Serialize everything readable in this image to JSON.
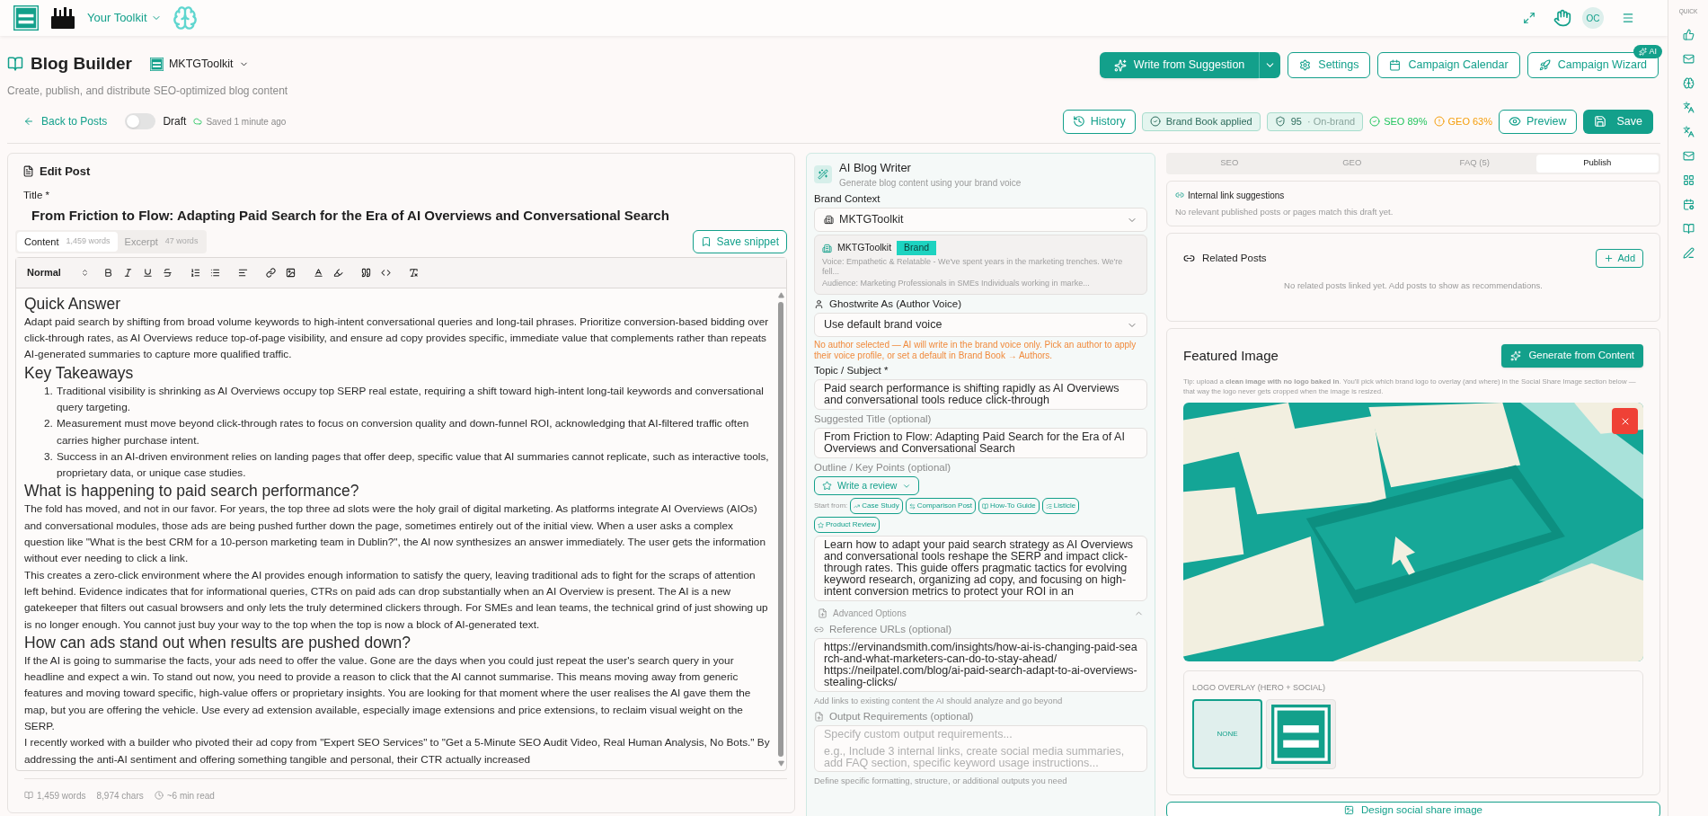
{
  "top_bar": {
    "toolkit_label": "Your Toolkit",
    "avatar": "OC"
  },
  "quick_rail": {
    "title": "QUICK"
  },
  "header": {
    "title": "Blog Builder",
    "brand": "MKTGToolkit",
    "subtitle": "Create, publish, and distribute SEO-optimized blog content",
    "actions": [
      {
        "kind": "split",
        "label": "Write from Suggestion"
      },
      {
        "kind": "outline",
        "label": "Settings"
      },
      {
        "kind": "outline",
        "label": "Campaign Calendar"
      },
      {
        "kind": "outline",
        "label": "Campaign Wizard",
        "badge": "AI"
      }
    ]
  },
  "post_bar": {
    "back": "Back to Posts",
    "draft_on": false,
    "draft_label": "Draft",
    "saved": "Saved 1 minute ago",
    "items": [
      {
        "kind": "outline",
        "label": "History"
      },
      {
        "kind": "chip",
        "label": "Brand Book applied"
      },
      {
        "kind": "score",
        "label": "95",
        "note": "· On-brand"
      },
      {
        "kind": "metric",
        "label": "SEO 89%",
        "color": "#22c55e"
      },
      {
        "kind": "metric",
        "label": "GEO 63%",
        "color": "#f59e0b"
      },
      {
        "kind": "outline",
        "label": "Preview"
      },
      {
        "kind": "primary",
        "label": "Save"
      }
    ]
  },
  "editor": {
    "title": "Edit Post",
    "title_label": "Title *",
    "title_value": "From Friction to Flow: Adapting Paid Search for the Era of AI Overviews and Conversational Search",
    "tabs": [
      {
        "label": "Content",
        "count": "1,459 words",
        "selected": true
      },
      {
        "label": "Excerpt",
        "count": "47 words",
        "selected": false
      }
    ],
    "save_snippet": "Save snippet",
    "format": "Normal",
    "blocks": [
      {
        "kind": "heading",
        "text": "Quick Answer"
      },
      {
        "kind": "paragraph",
        "text": "Adapt paid search by shifting from broad volume keywords to high-intent conversational queries and long-tail phrases. Prioritize conversion-based bidding over click-through rates, as AI Overviews reduce top-of-page visibility, and ensure ad copy provides specific, immediate value that complements rather than repeats AI-generated summaries to capture more qualified traffic."
      },
      {
        "kind": "heading",
        "text": "Key Takeaways"
      },
      {
        "kind": "list",
        "items": [
          {
            "marker": "1.",
            "text": "Traditional visibility is shrinking as AI Overviews occupy top SERP real estate, requiring a shift toward high-intent long-tail keywords and conversational query targeting."
          },
          {
            "marker": "2.",
            "text": "Measurement must move beyond click-through rates to focus on conversion quality and down-funnel ROI, acknowledging that AI-filtered traffic often carries higher purchase intent."
          },
          {
            "marker": "3.",
            "text": "Success in an AI-driven environment relies on landing pages that offer deep, specific value that AI summaries cannot replicate, such as interactive tools, proprietary data, or unique case studies."
          }
        ]
      },
      {
        "kind": "heading",
        "text": "What is happening to paid search performance?"
      },
      {
        "kind": "paragraph",
        "text": "The fold has moved, and not in our favor. For years, the top three ad slots were the holy grail of digital marketing. As platforms integrate AI Overviews (AIOs) and conversational modules, those ads are being pushed further down the page, sometimes entirely out of the initial view. When a user asks a complex question like \"What is the best CRM for a 10-person marketing team in Dublin?\", the AI now synthesizes an answer immediately. The user gets the information without ever needing to click a link."
      },
      {
        "kind": "paragraph",
        "text": "This creates a zero-click environment where the AI provides enough information to satisfy the query, leaving traditional ads to fight for the scraps of attention left behind. Evidence indicates that for informational queries, CTRs on paid ads can drop substantially when an AI Overview is present. The AI is a new gatekeeper that filters out casual browsers and only lets the truly determined clickers through. For SMEs and lean teams, the technical grind of just showing up is no longer enough. You cannot just buy your way to the top when the top is now a block of AI-generated text."
      },
      {
        "kind": "heading",
        "text": "How can ads stand out when results are pushed down?"
      },
      {
        "kind": "paragraph",
        "text": "If the AI is going to summarise the facts, your ads need to offer the value. Gone are the days when you could just repeat the user's search query in your headline and expect a win. To stand out now, you need to provide a reason to click that the AI cannot summarise. This means moving away from generic features and moving toward specific, high-value offers or proprietary insights. You are looking for that moment where the user realises the AI gave them the map, but you are offering the vehicle. Use every ad extension available, especially image extensions and price extensions, to reclaim visual weight on the SERP."
      },
      {
        "kind": "paragraph",
        "text": "I recently worked with a builder who pivoted their ad copy from \"Expert SEO Services\" to \"Get a 5-Minute SEO Audit Video, Real Human Analysis, No Bots.\" By addressing the anti-AI sentiment and offering something tangible and personal, their CTR actually increased"
      }
    ],
    "stats": [
      "1,459 words",
      "8,974 chars",
      "~6 min read"
    ]
  },
  "writer": {
    "title": "AI Blog Writer",
    "subtitle": "Generate blog content using your brand voice",
    "brand_context_label": "Brand Context",
    "brand_context_value": "MKTGToolkit",
    "brand_card": {
      "name": "MKTGToolkit",
      "badge": "Brand",
      "voice": "Voice: Empathetic & Relatable - We've spent years in the marketing trenches. We're fell...",
      "audience": "Audience: Marketing Professionals in SMEs Individuals working in marke..."
    },
    "author_label": "Ghostwrite As (Author Voice)",
    "author_value": "Use default brand voice",
    "author_warning": "No author selected — AI will write in the brand voice only. Pick an author to apply their voice profile, or set a default in Brand Book → Authors.",
    "topic_label": "Topic / Subject *",
    "topic_value": "Paid search performance is shifting rapidly as AI Overviews and conversational tools reduce click-through",
    "suggested_title_label": "Suggested Title (optional)",
    "suggested_title_value": "From Friction to Flow: Adapting Paid Search for the Era of AI Overviews and Conversational Search",
    "outline_label": "Outline / Key Points (optional)",
    "review_button": "Write a review",
    "start_from_label": "Start from:",
    "templates": [
      "Case Study",
      "Comparison Post",
      "How-To Guide",
      "Listicle",
      "Product Review"
    ],
    "outline_value": "Learn how to adapt your paid search strategy as AI Overviews and conversational tools reshape the SERP and impact click-through rates. This guide offers pragmatic tactics for evolving keyword research, organizing ad copy, and focusing on high-intent conversion metrics to protect your ROI in an",
    "advanced": {
      "label": "Advanced Options",
      "expanded": true
    },
    "reference_label": "Reference URLs (optional)",
    "reference_urls": [
      "https://ervinandsmith.com/insights/how-ai-is-changing-paid-search-and-what-marketers-can-do-to-stay-ahead/",
      "https://neilpatel.com/blog/ai-paid-search-adapt-to-ai-overviews-stealing-clicks/"
    ],
    "reference_hint": "Add links to existing content the AI should analyze and go beyond",
    "output_label": "Output Requirements (optional)",
    "output_placeholder": [
      "Specify custom output requirements...",
      "e.g., Include 3 internal links, create social media summaries, add FAQ section, specific keyword usage instructions..."
    ],
    "output_hint": "Define specific formatting, structure, or additional outputs you need"
  },
  "side": {
    "tabs": [
      {
        "label": "SEO",
        "selected": false
      },
      {
        "label": "GEO",
        "selected": false
      },
      {
        "label": "FAQ (5)",
        "selected": false
      },
      {
        "label": "Publish",
        "selected": true
      }
    ],
    "internal_links": {
      "title": "Internal link suggestions",
      "empty": "No relevant published posts or pages match this draft yet."
    },
    "related": {
      "title": "Related Posts",
      "add": "Add",
      "empty": "No related posts linked yet. Add posts to show as recommendations."
    },
    "featured": {
      "title": "Featured Image",
      "generate": "Generate from Content",
      "tip": "Tip: upload a **clean image with no logo baked in**. You'll pick which brand logo to overlay (and where) in the Social Share Image section below — that way the logo never gets cropped when the image is resized.",
      "overlay_label": "LOGO OVERLAY (HERO + SOCIAL)",
      "overlay_options": [
        {
          "kind": "none",
          "label": "NONE",
          "selected": true
        },
        {
          "kind": "logo",
          "selected": false
        }
      ]
    },
    "design_button": "Design social share image"
  }
}
